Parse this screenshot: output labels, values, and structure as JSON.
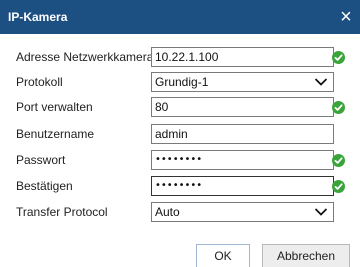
{
  "dialog": {
    "title": "IP-Kamera",
    "close_label": "×"
  },
  "form": {
    "address": {
      "label": "Adresse Netzwerkkamera",
      "value": "10.22.1.100"
    },
    "protocol": {
      "label": "Protokoll",
      "value": "Grundig-1"
    },
    "port": {
      "label": "Port verwalten",
      "value": "80"
    },
    "username": {
      "label": "Benutzername",
      "value": "admin"
    },
    "password": {
      "label": "Passwort",
      "value": "••••••••"
    },
    "confirm": {
      "label": "Bestätigen",
      "value": "••••••••"
    },
    "transfer": {
      "label": "Transfer Protocol",
      "value": "Auto"
    }
  },
  "buttons": {
    "ok": "OK",
    "cancel": "Abbrechen"
  },
  "colors": {
    "titlebar": "#1c4f82",
    "check_green": "#3aa43a"
  },
  "icons": {
    "valid": "check-circle-icon",
    "dropdown": "chevron-down-icon",
    "close": "close-icon"
  }
}
